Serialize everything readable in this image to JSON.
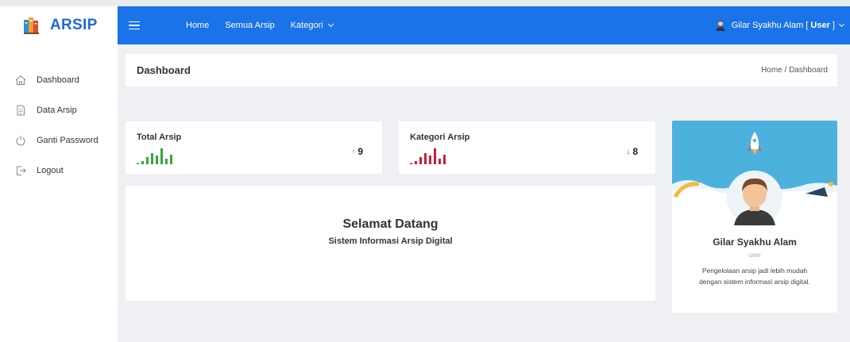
{
  "brand": {
    "name": "ARSIP"
  },
  "sidebar": {
    "items": [
      {
        "label": "Dashboard",
        "icon": "home-icon"
      },
      {
        "label": "Data Arsip",
        "icon": "document-icon"
      },
      {
        "label": "Ganti Password",
        "icon": "power-icon"
      },
      {
        "label": "Logout",
        "icon": "logout-icon"
      }
    ]
  },
  "topbar": {
    "nav": [
      {
        "label": "Home"
      },
      {
        "label": "Semua Arsip"
      },
      {
        "label": "Kategori"
      }
    ],
    "user": {
      "name": "Gilar Syakhu Alam [ ",
      "role": "User",
      "suffix": " ]"
    }
  },
  "header": {
    "title": "Dashboard",
    "breadcrumb": "Home / Dashboard"
  },
  "stats": [
    {
      "title": "Total Arsip",
      "value": "9",
      "color": "#3aa53a",
      "bars": [
        0.2,
        0.45,
        0.7,
        0.55,
        1.0,
        0.35,
        0.6
      ]
    },
    {
      "title": "Kategori Arsip",
      "value": "8",
      "color": "#c4203c",
      "bars": [
        0.2,
        0.45,
        0.7,
        0.55,
        1.0,
        0.35,
        0.6
      ]
    }
  ],
  "welcome": {
    "title": "Selamat Datang",
    "subtitle": "Sistem Informasi Arsip Digital"
  },
  "profile": {
    "name": "Gilar Syakhu Alam",
    "role": "user",
    "desc_line1": "Pengelolaan arsip jadi lebih mudah",
    "desc_line2": "dengan sistem informasi arsip digital."
  },
  "colors": {
    "primary": "#1a73e8",
    "brand": "#1f6ad6",
    "banner": "#4cb2dd"
  }
}
